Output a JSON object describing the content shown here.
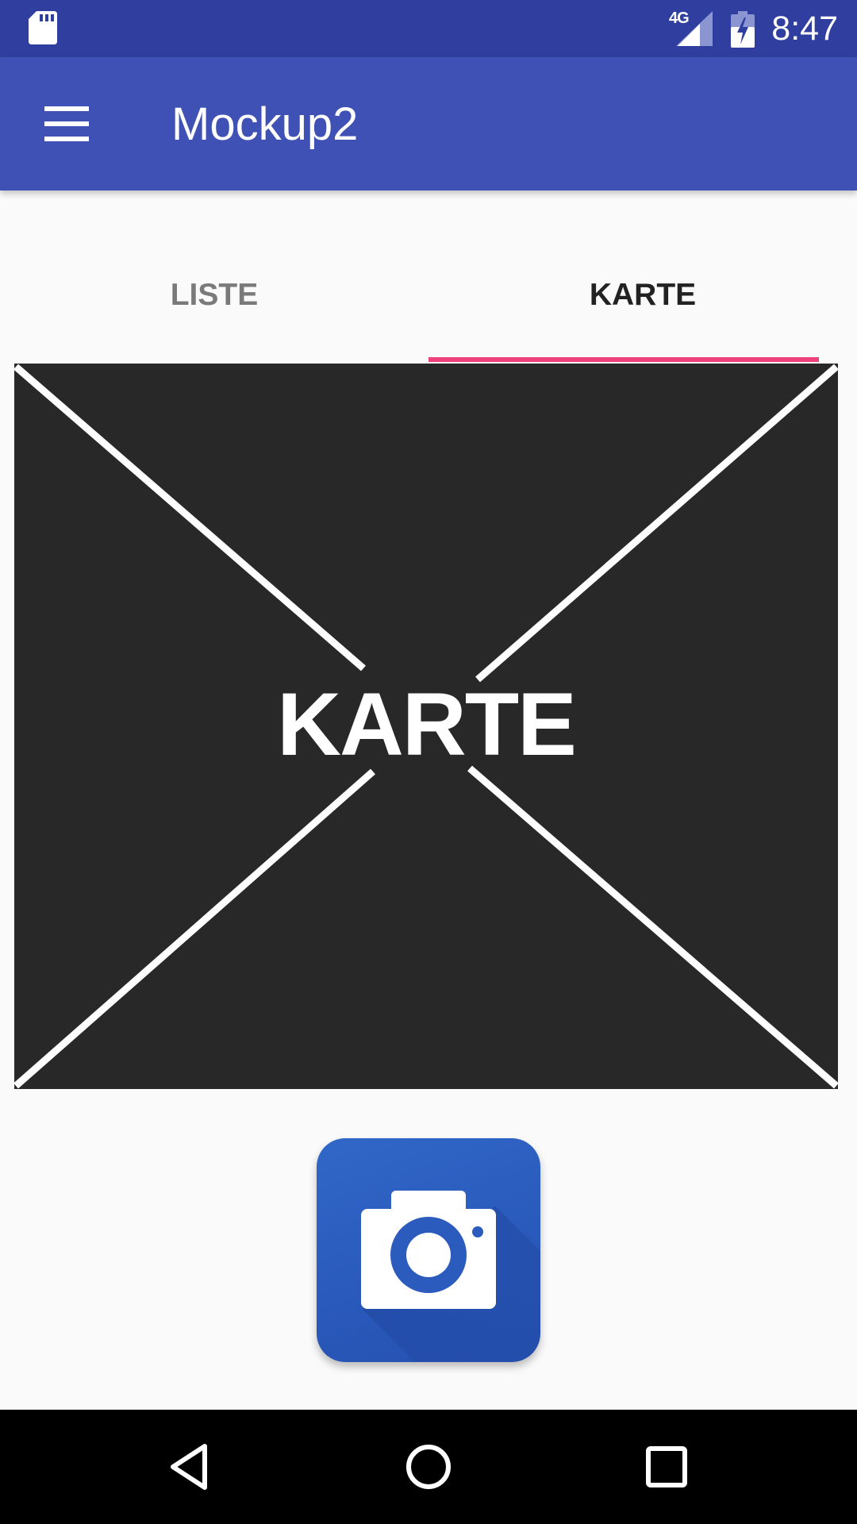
{
  "status_bar": {
    "network_type": "4G",
    "time": "8:47",
    "icons": [
      "sd-card-icon",
      "signal-icon",
      "battery-charging-icon"
    ]
  },
  "app_bar": {
    "title": "Mockup2",
    "menu_icon": "hamburger-menu-icon"
  },
  "tabs": [
    {
      "label": "LISTE",
      "selected": false
    },
    {
      "label": "KARTE",
      "selected": true
    }
  ],
  "map_placeholder": {
    "label": "KARTE"
  },
  "camera_button": {
    "icon": "camera-icon"
  },
  "nav_bar": {
    "icons": [
      "back-icon",
      "home-icon",
      "recents-icon"
    ]
  },
  "colors": {
    "status_bar": "#303f9f",
    "primary": "#3f51b5",
    "tab_indicator": "#ee407a",
    "background": "#fafafa",
    "map_background": "#282828",
    "camera_blue": "#2a5bbd"
  }
}
